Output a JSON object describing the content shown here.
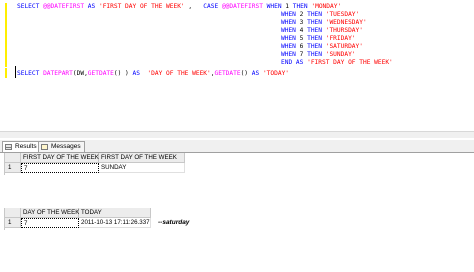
{
  "editor": {
    "lines": [
      {
        "parts": [
          {
            "t": "SELECT ",
            "c": "kw"
          },
          {
            "t": "@@DATEFIRST ",
            "c": "fn"
          },
          {
            "t": "AS ",
            "c": "kw"
          },
          {
            "t": "'FIRST DAY OF THE WEEK'",
            "c": "str"
          },
          {
            "t": " ,   ",
            "c": "var"
          },
          {
            "t": "CASE ",
            "c": "kw"
          },
          {
            "t": "@@DATEFIRST ",
            "c": "fn"
          },
          {
            "t": "WHEN ",
            "c": "kw"
          },
          {
            "t": "1 ",
            "c": "var"
          },
          {
            "t": "THEN ",
            "c": "kw"
          },
          {
            "t": "'MONDAY'",
            "c": "str"
          }
        ]
      },
      {
        "parts": [
          {
            "t": "WHEN ",
            "c": "kw"
          },
          {
            "t": "2 ",
            "c": "var"
          },
          {
            "t": "THEN ",
            "c": "kw"
          },
          {
            "t": "'TUESDAY'",
            "c": "str"
          }
        ]
      },
      {
        "parts": [
          {
            "t": "WHEN ",
            "c": "kw"
          },
          {
            "t": "3 ",
            "c": "var"
          },
          {
            "t": "THEN ",
            "c": "kw"
          },
          {
            "t": "'WEDNESDAY'",
            "c": "str"
          }
        ]
      },
      {
        "parts": [
          {
            "t": "WHEN ",
            "c": "kw"
          },
          {
            "t": "4 ",
            "c": "var"
          },
          {
            "t": "THEN ",
            "c": "kw"
          },
          {
            "t": "'THURSDAY'",
            "c": "str"
          }
        ]
      },
      {
        "parts": [
          {
            "t": "WHEN ",
            "c": "kw"
          },
          {
            "t": "5 ",
            "c": "var"
          },
          {
            "t": "THEN ",
            "c": "kw"
          },
          {
            "t": "'FRIDAY'",
            "c": "str"
          }
        ]
      },
      {
        "parts": [
          {
            "t": "WHEN ",
            "c": "kw"
          },
          {
            "t": "6 ",
            "c": "var"
          },
          {
            "t": "THEN ",
            "c": "kw"
          },
          {
            "t": "'SATURDAY'",
            "c": "str"
          }
        ]
      },
      {
        "parts": [
          {
            "t": "WHEN ",
            "c": "kw"
          },
          {
            "t": "7 ",
            "c": "var"
          },
          {
            "t": "THEN ",
            "c": "kw"
          },
          {
            "t": "'SUNDAY'",
            "c": "str"
          }
        ]
      },
      {
        "parts": [
          {
            "t": "END ",
            "c": "kw"
          },
          {
            "t": "AS ",
            "c": "kw"
          },
          {
            "t": "'FIRST DAY OF THE WEEK'",
            "c": "str"
          }
        ]
      },
      {
        "parts": [
          {
            "t": "SELECT ",
            "c": "kw"
          },
          {
            "t": "DATEPART",
            "c": "fn"
          },
          {
            "t": "(DW,",
            "c": "var"
          },
          {
            "t": "GETDATE",
            "c": "fn"
          },
          {
            "t": "() ) ",
            "c": "var"
          },
          {
            "t": "AS  ",
            "c": "kw"
          },
          {
            "t": "'DAY OF THE WEEK'",
            "c": "str"
          },
          {
            "t": ",",
            "c": "var"
          },
          {
            "t": "GETDATE",
            "c": "fn"
          },
          {
            "t": "() ",
            "c": "var"
          },
          {
            "t": "AS ",
            "c": "kw"
          },
          {
            "t": "'TODAY'",
            "c": "str"
          }
        ]
      }
    ]
  },
  "tabs": [
    {
      "label": "Results",
      "icon": "grid-icon"
    },
    {
      "label": "Messages",
      "icon": "messages-icon"
    }
  ],
  "grid1": {
    "columns": [
      "FIRST DAY OF THE WEEK",
      "FIRST DAY OF THE WEEK"
    ],
    "rows": [
      {
        "num": "1",
        "cells": [
          "7",
          "SUNDAY"
        ]
      }
    ]
  },
  "grid2": {
    "columns": [
      "DAY OF THE WEEK",
      "TODAY"
    ],
    "rows": [
      {
        "num": "1",
        "cells": [
          "7",
          "2011-10-13 17:11:26.337"
        ]
      }
    ]
  },
  "note": "--saturday"
}
